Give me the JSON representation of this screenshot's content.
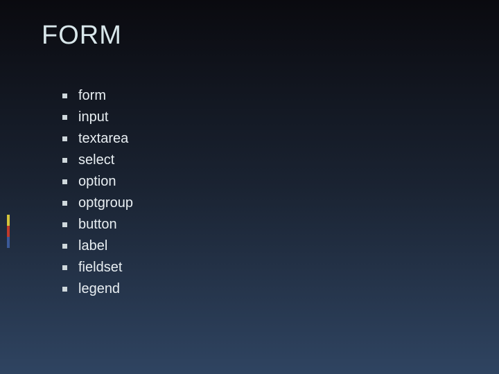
{
  "slide": {
    "title": "FORM",
    "bullets": [
      "form",
      "input",
      "textarea",
      "select",
      "option",
      "optgroup",
      "button",
      "label",
      "fieldset",
      "legend"
    ]
  }
}
